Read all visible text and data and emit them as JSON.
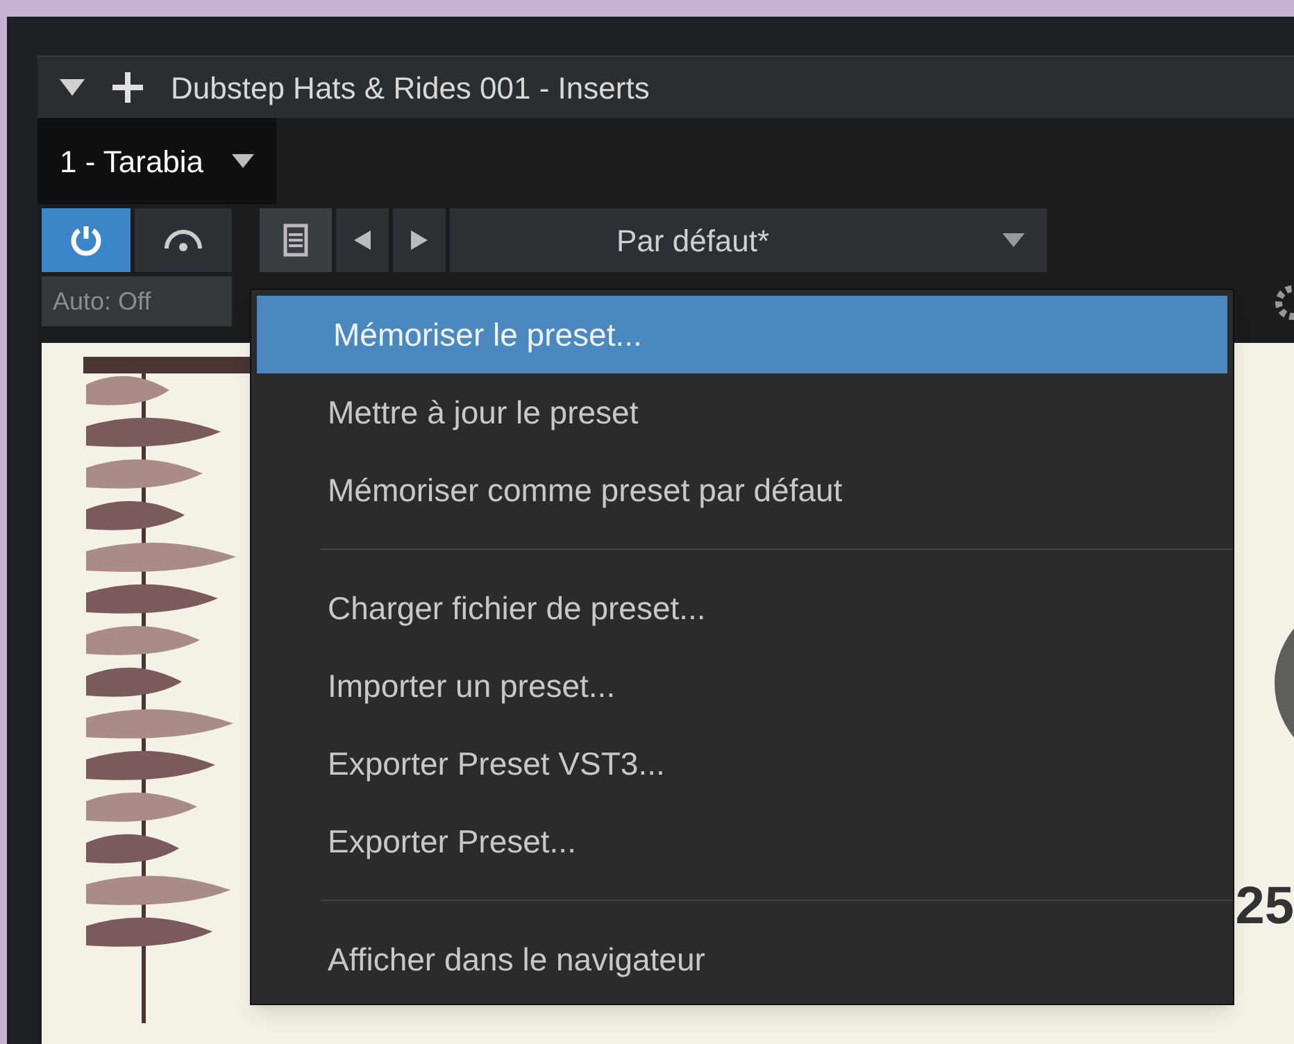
{
  "window": {
    "title": "Dubstep Hats & Rides 001 - Inserts"
  },
  "tabs": [
    {
      "label": "1 - Tarabia",
      "selected": true
    }
  ],
  "toolbar": {
    "power_on": true,
    "preset": "Par défaut*",
    "automation": "Auto: Off"
  },
  "plugin": {
    "number": "25"
  },
  "menu": {
    "items": [
      {
        "kind": "item",
        "label": "Mémoriser le preset...",
        "selected": true
      },
      {
        "kind": "item",
        "label": "Mettre à jour le preset",
        "selected": false
      },
      {
        "kind": "item",
        "label": "Mémoriser comme preset par défaut",
        "selected": false
      },
      {
        "kind": "separator"
      },
      {
        "kind": "item",
        "label": "Charger fichier de preset...",
        "selected": false
      },
      {
        "kind": "item",
        "label": "Importer un preset...",
        "selected": false
      },
      {
        "kind": "item",
        "label": "Exporter Preset VST3...",
        "selected": false
      },
      {
        "kind": "item",
        "label": "Exporter Preset...",
        "selected": false
      },
      {
        "kind": "separator"
      },
      {
        "kind": "item",
        "label": "Afficher dans le navigateur",
        "selected": false
      }
    ]
  }
}
